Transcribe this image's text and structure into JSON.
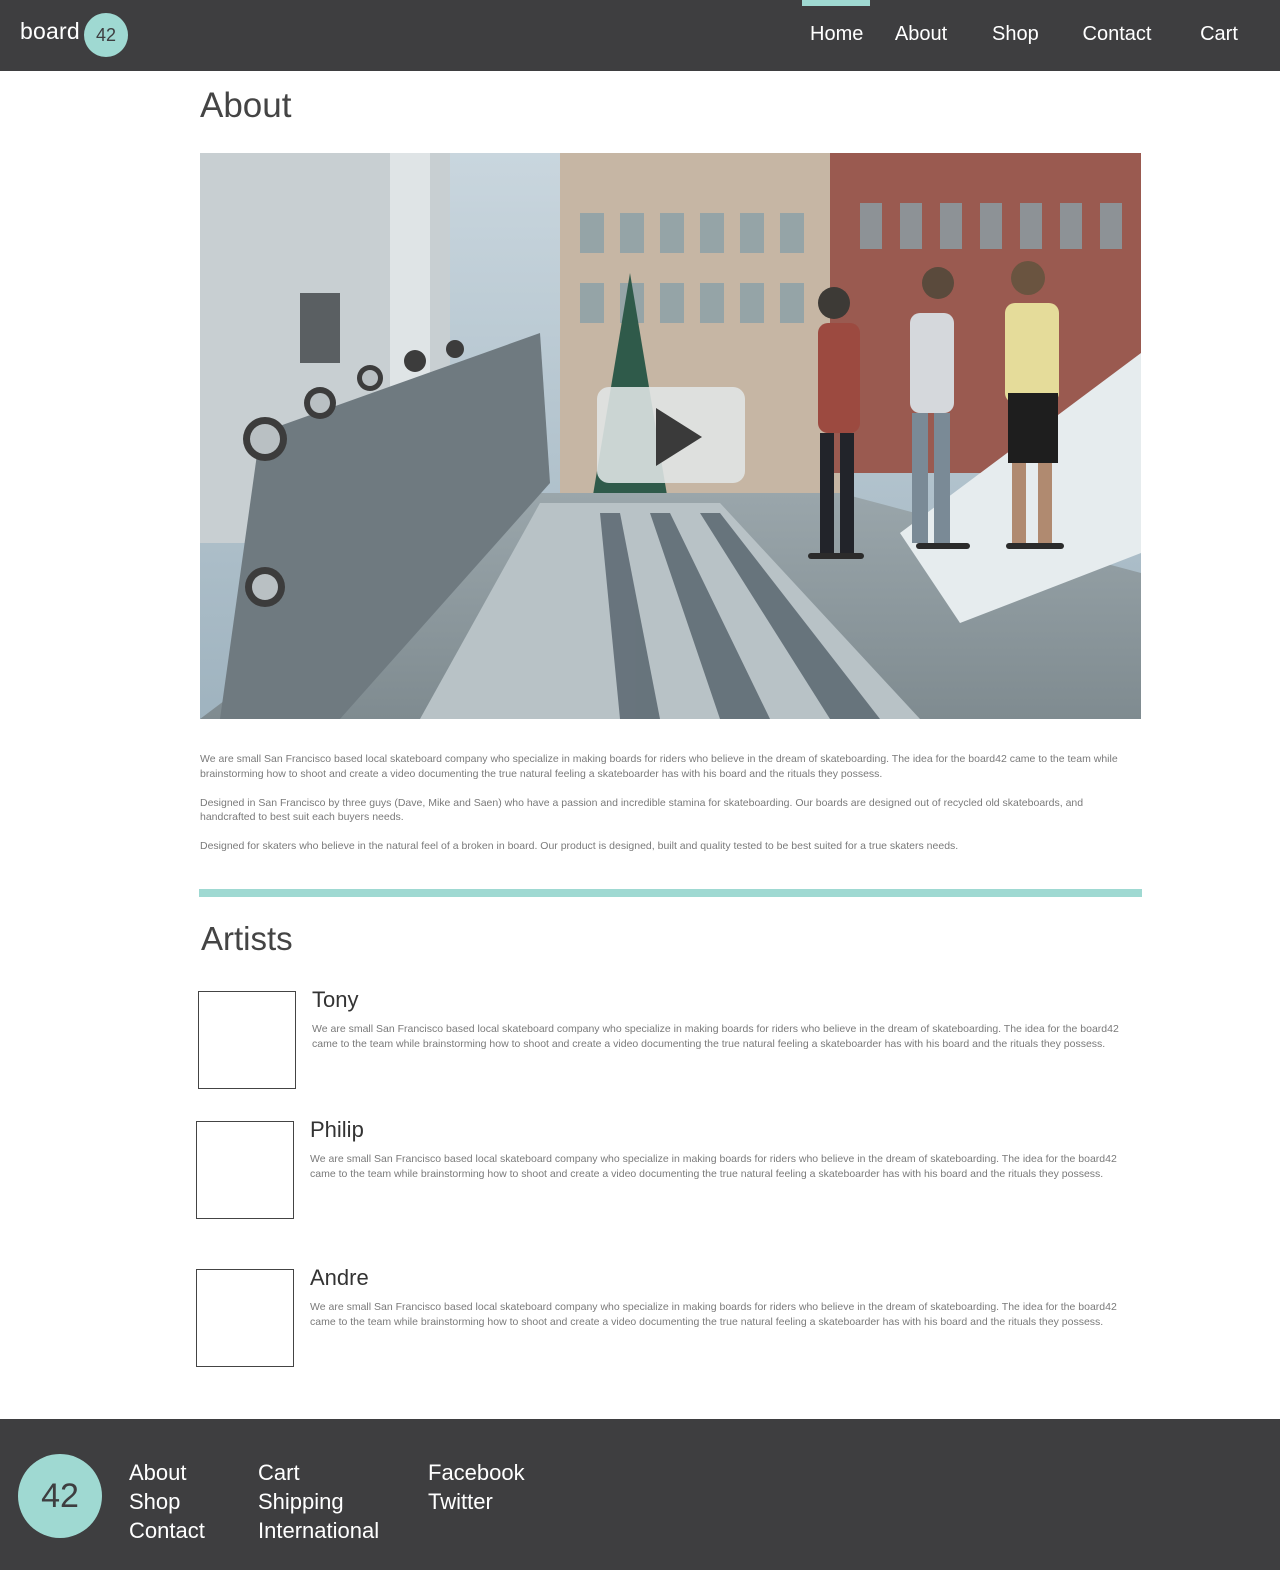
{
  "header": {
    "logo_text": "board",
    "logo_badge": "42",
    "nav": [
      {
        "label": "Home",
        "active": true
      },
      {
        "label": "About"
      },
      {
        "label": "Shop"
      },
      {
        "label": "Contact"
      },
      {
        "label": "Cart"
      }
    ]
  },
  "about": {
    "title": "About",
    "video": {
      "image_description": "skateboarders on a bridge",
      "play_icon": "play-icon"
    },
    "paragraphs": [
      "We are small San Francisco based local skateboard company who specialize in making boards for riders who believe in the dream of skateboarding. The idea for the board42 came to the team while brainstorming how to shoot and create a video documenting the true natural feeling a skateboarder has with his board and the rituals they possess.",
      "Designed in San Francisco by three guys (Dave, Mike and Saen) who have a passion and incredible stamina for skateboarding. Our boards are designed out of recycled old skateboards, and handcrafted to best suit each buyers needs.",
      "Designed for skaters who believe in the natural feel of a broken in board. Our product is designed, built and quality tested to be best suited for a true skaters needs."
    ]
  },
  "artists": {
    "title": "Artists",
    "items": [
      {
        "name": "Tony",
        "bio": "We are small San Francisco based local skateboard company who specialize in making boards for riders who believe in the dream of skateboarding. The idea for the board42 came to the team while brainstorming how to shoot and create a video documenting the true natural feeling a skateboarder has with his board and the rituals they possess."
      },
      {
        "name": "Philip",
        "bio": "We are small San Francisco based local skateboard company who specialize in making boards for riders who believe in the dream of skateboarding. The idea for the board42 came to the team while brainstorming how to shoot and create a video documenting the true natural feeling a skateboarder has with his board and the rituals they possess."
      },
      {
        "name": "Andre",
        "bio": "We are small San Francisco based local skateboard company who specialize in making boards for riders who believe in the dream of skateboarding. The idea for the board42 came to the team while brainstorming how to shoot and create a video documenting the true natural feeling a skateboarder has with his board and the rituals they possess."
      }
    ]
  },
  "footer": {
    "badge": "42",
    "col1": [
      "About",
      "Shop",
      "Contact"
    ],
    "col2": [
      "Cart",
      "Shipping",
      "International"
    ],
    "col3": [
      "Facebook",
      "Twitter"
    ]
  },
  "colors": {
    "accent": "#9fd9d2",
    "bar": "#3e3e40"
  }
}
